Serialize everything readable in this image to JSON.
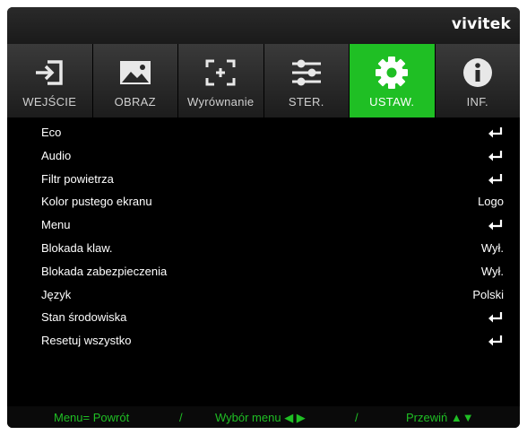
{
  "brand": {
    "logo": "vivitek"
  },
  "colors": {
    "accent": "#1fbf24",
    "background": "#000000"
  },
  "tabs": [
    {
      "label": "WEJŚCIE",
      "icon": "input-icon",
      "active": false
    },
    {
      "label": "OBRAZ",
      "icon": "image-icon",
      "active": false
    },
    {
      "label": "Wyrównanie",
      "icon": "alignment-icon",
      "active": false
    },
    {
      "label": "STER.",
      "icon": "sliders-icon",
      "active": false
    },
    {
      "label": "USTAW.",
      "icon": "gear-icon",
      "active": true
    },
    {
      "label": "INF.",
      "icon": "info-icon",
      "active": false
    }
  ],
  "menu": [
    {
      "label": "Eco",
      "value": "",
      "type": "enter"
    },
    {
      "label": "Audio",
      "value": "",
      "type": "enter"
    },
    {
      "label": "Filtr powietrza",
      "value": "",
      "type": "enter"
    },
    {
      "label": "Kolor pustego ekranu",
      "value": "Logo",
      "type": "value"
    },
    {
      "label": "Menu",
      "value": "",
      "type": "enter"
    },
    {
      "label": "Blokada klaw.",
      "value": "Wył.",
      "type": "value"
    },
    {
      "label": "Blokada zabezpieczenia",
      "value": "Wył.",
      "type": "value"
    },
    {
      "label": "Język",
      "value": "Polski",
      "type": "value"
    },
    {
      "label": "Stan środowiska",
      "value": "",
      "type": "enter"
    },
    {
      "label": "Resetuj wszystko",
      "value": "",
      "type": "enter"
    }
  ],
  "footer": {
    "back": "Menu= Powrót",
    "sep1": "/",
    "select": "Wybór menu ◀ ▶",
    "sep2": "/",
    "scroll": "Przewiń ▲▼"
  }
}
